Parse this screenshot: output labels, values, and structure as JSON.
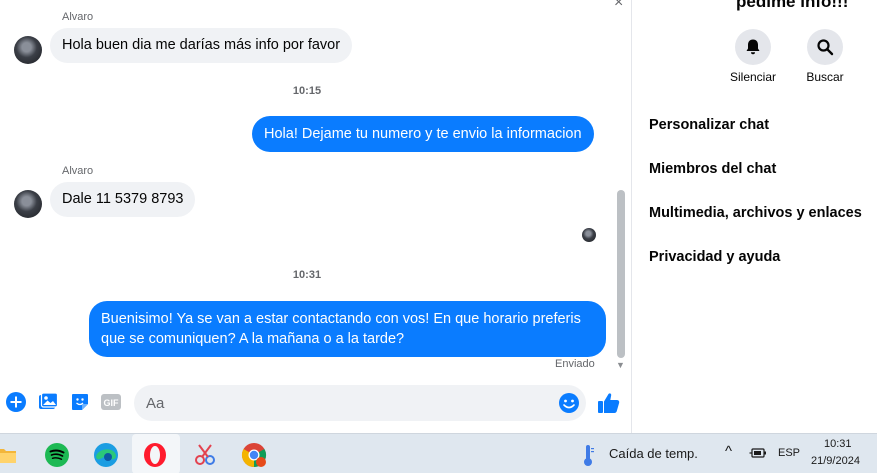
{
  "messages": {
    "sender1": "Alvaro",
    "msg1": "Hola buen dia me darías más info por favor",
    "time1": "10:15",
    "msg2": "Hola! Dejame tu numero y te envio la informacion",
    "sender2": "Alvaro",
    "msg3": "Dale 11 5379 8793",
    "time2": "10:31",
    "msg4": "Buenisimo! Ya se van a estar contactando con vos! En que horario preferis que se comuniquen? A la mañana o a la tarde?",
    "status": "Enviado"
  },
  "composer": {
    "placeholder": "Aa",
    "gif_label": "GIF"
  },
  "right_panel": {
    "title": "pedime info!!!",
    "mute_label": "Silenciar",
    "search_label": "Buscar",
    "items": [
      "Personalizar chat",
      "Miembros del chat",
      "Multimedia, archivos y enlaces",
      "Privacidad y ayuda"
    ]
  },
  "taskbar": {
    "weather": "Caída de temp.",
    "language": "ESP",
    "time": "10:31",
    "date": "21/9/2024"
  },
  "colors": {
    "accent": "#0a7cff",
    "incoming_bubble": "#f0f2f5",
    "taskbar": "#dfe7ef"
  }
}
